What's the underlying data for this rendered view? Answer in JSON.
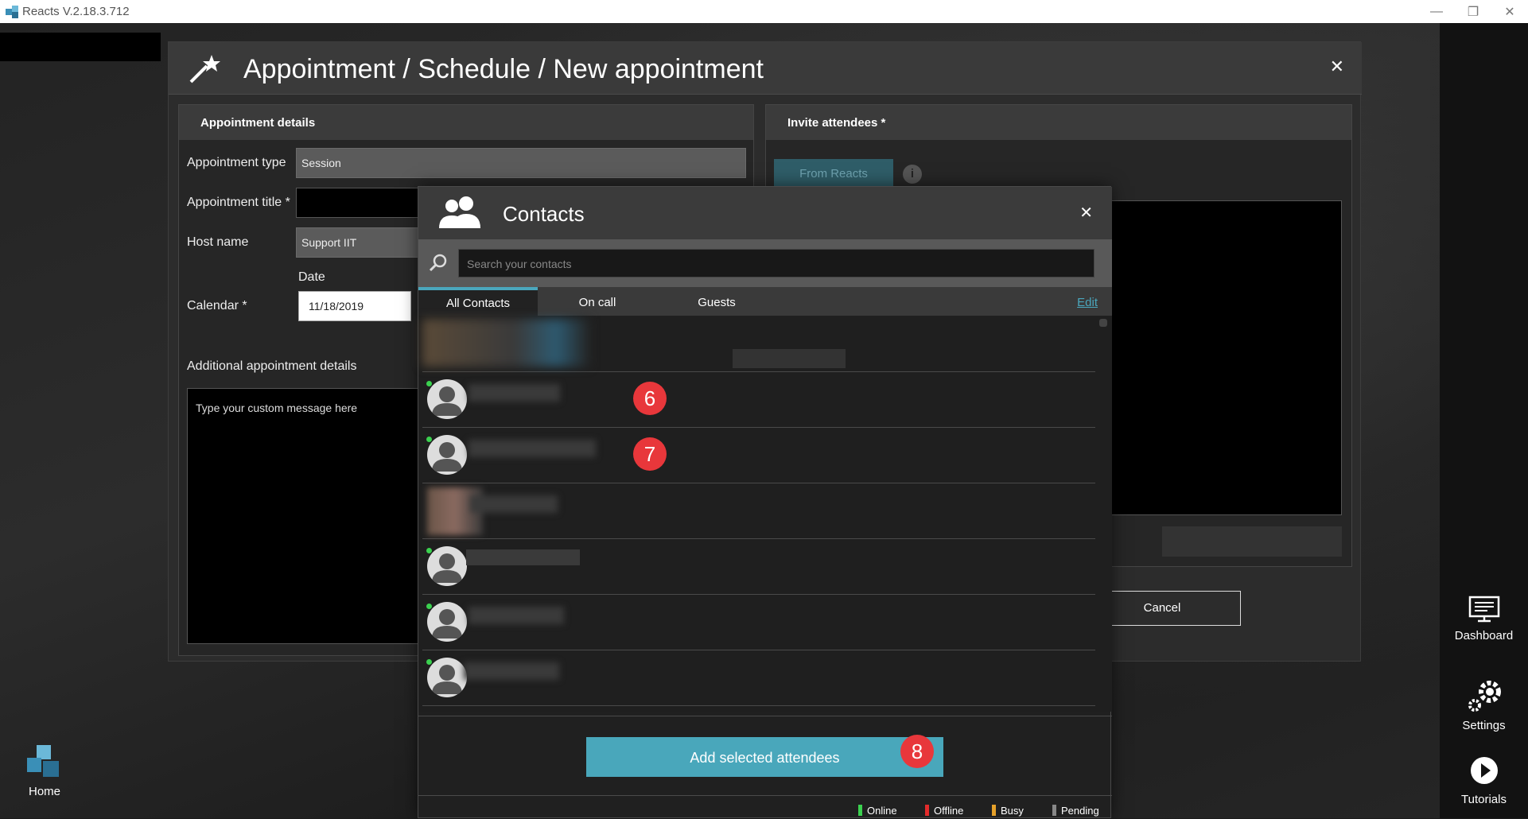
{
  "window": {
    "title": "Reacts V.2.18.3.712"
  },
  "appointment": {
    "title": "Appointment / Schedule / New appointment",
    "details_header": "Appointment details",
    "type_label": "Appointment type",
    "type_value": "Session",
    "title_label": "Appointment title *",
    "host_label": "Host name",
    "host_value": "Support IIT",
    "date_label": "Date",
    "calendar_label": "Calendar *",
    "calendar_value": "11/18/2019",
    "additional_label": "Additional appointment details",
    "message_placeholder": "Type your custom message here",
    "invite_header": "Invite attendees *",
    "from_reacts_tab": "From Reacts",
    "cancel_label": "Cancel"
  },
  "contacts": {
    "title": "Contacts",
    "search_placeholder": "Search your contacts",
    "tabs": [
      "All Contacts",
      "On call",
      "Guests"
    ],
    "edit_label": "Edit",
    "badges": [
      "6",
      "7",
      "8"
    ],
    "add_label": "Add selected attendees",
    "legend": [
      "Online",
      "Offline",
      "Busy",
      "Pending"
    ]
  },
  "sidebar": {
    "dashboard": "Dashboard",
    "settings": "Settings",
    "tutorials": "Tutorials",
    "home": "Home"
  },
  "colors": {
    "accent": "#49a7bb",
    "badge": "#e8373b",
    "online": "#3bd14f",
    "offline": "#e32b2b",
    "busy": "#e6a12a",
    "pending": "#888888"
  }
}
